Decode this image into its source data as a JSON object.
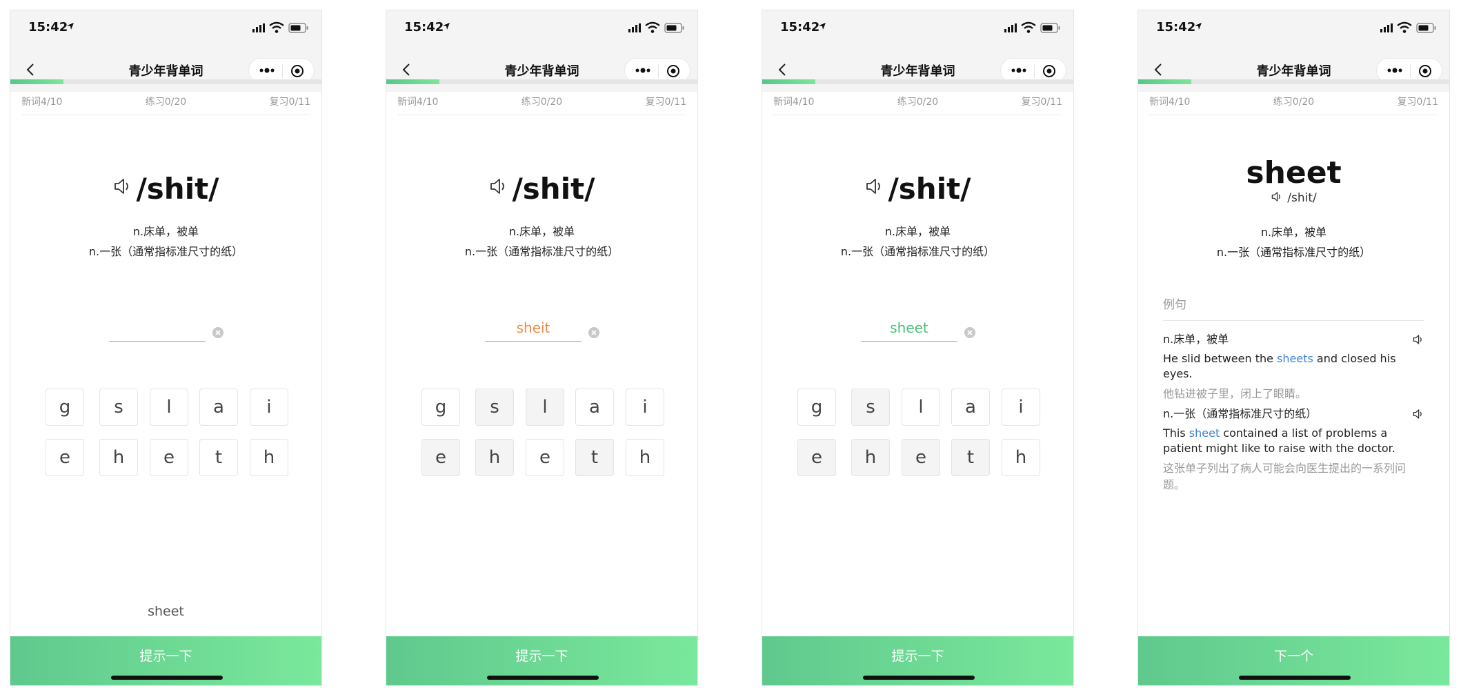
{
  "status_bar": {
    "time": "15:42"
  },
  "nav": {
    "title": "青少年背单词"
  },
  "progress": {
    "fraction": 0.17
  },
  "stats": {
    "new_words": "新词4/10",
    "practice": "练习0/20",
    "review": "复习0/11"
  },
  "word": {
    "spelling": "sheet",
    "phonetic": "/shit/",
    "definitions": [
      "n.床单，被单",
      "n.一张（通常指标准尺寸的纸）"
    ]
  },
  "screens": [
    {
      "answer": "",
      "answer_color": "#333333",
      "keys": [
        "g",
        "s",
        "l",
        "a",
        "i",
        "e",
        "h",
        "e",
        "t",
        "h"
      ],
      "used": [
        false,
        false,
        false,
        false,
        false,
        false,
        false,
        false,
        false,
        false
      ],
      "hint_word": "sheet",
      "button": "提示一下"
    },
    {
      "answer": "sheit",
      "answer_color": "#f08a4b",
      "keys": [
        "g",
        "s",
        "l",
        "a",
        "i",
        "e",
        "h",
        "e",
        "t",
        "h"
      ],
      "used": [
        false,
        true,
        true,
        false,
        false,
        true,
        true,
        false,
        true,
        false
      ],
      "hint_word": "",
      "button": "提示一下"
    },
    {
      "answer": "sheet",
      "answer_color": "#4cc17a",
      "keys": [
        "g",
        "s",
        "l",
        "a",
        "i",
        "e",
        "h",
        "e",
        "t",
        "h"
      ],
      "used": [
        false,
        true,
        false,
        false,
        false,
        true,
        true,
        true,
        true,
        false
      ],
      "hint_word": "",
      "button": "提示一下"
    }
  ],
  "detail": {
    "examples_label": "例句",
    "examples": [
      {
        "definition": "n.床单，被单",
        "en_before": "He slid between the ",
        "en_highlight": "sheets",
        "en_after": " and closed his eyes.",
        "cn": "他钻进被子里，闭上了眼睛。"
      },
      {
        "definition": "n.一张（通常指标准尺寸的纸）",
        "en_before": "This ",
        "en_highlight": "sheet",
        "en_after": " contained a list of problems a patient might like to raise with the doctor.",
        "cn": "这张单子列出了病人可能会向医生提出的一系列问题。"
      }
    ],
    "button": "下一个"
  },
  "colors": {
    "accent_start": "#5fc98d",
    "accent_end": "#7ae89b",
    "highlight": "#3b82d6"
  }
}
